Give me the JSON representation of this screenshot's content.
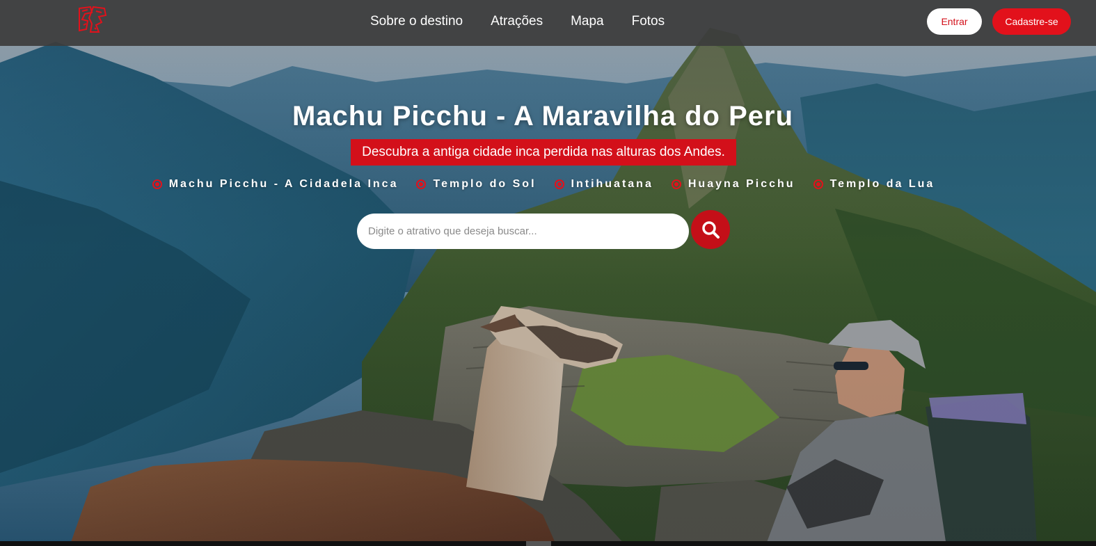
{
  "header": {
    "logo_name": "site-logo",
    "nav": [
      {
        "label": "Sobre o destino"
      },
      {
        "label": "Atrações"
      },
      {
        "label": "Mapa"
      },
      {
        "label": "Fotos"
      }
    ],
    "login_label": "Entrar",
    "signup_label": "Cadastre-se"
  },
  "hero": {
    "title": "Machu Picchu - A Maravilha do Peru",
    "subtitle": "Descubra a antiga cidade inca perdida nas alturas dos Andes.",
    "attractions": [
      {
        "label": "Machu Picchu - A Cidadela Inca"
      },
      {
        "label": "Templo do Sol"
      },
      {
        "label": "Intihuatana"
      },
      {
        "label": "Huayna Picchu"
      },
      {
        "label": "Templo da Lua"
      }
    ],
    "search": {
      "placeholder": "Digite o atrativo que deseja buscar...",
      "icon": "search-icon"
    }
  },
  "colors": {
    "accent_red": "#e2111b",
    "header_bg": "#3c3c3c",
    "text_white": "#ffffff"
  }
}
